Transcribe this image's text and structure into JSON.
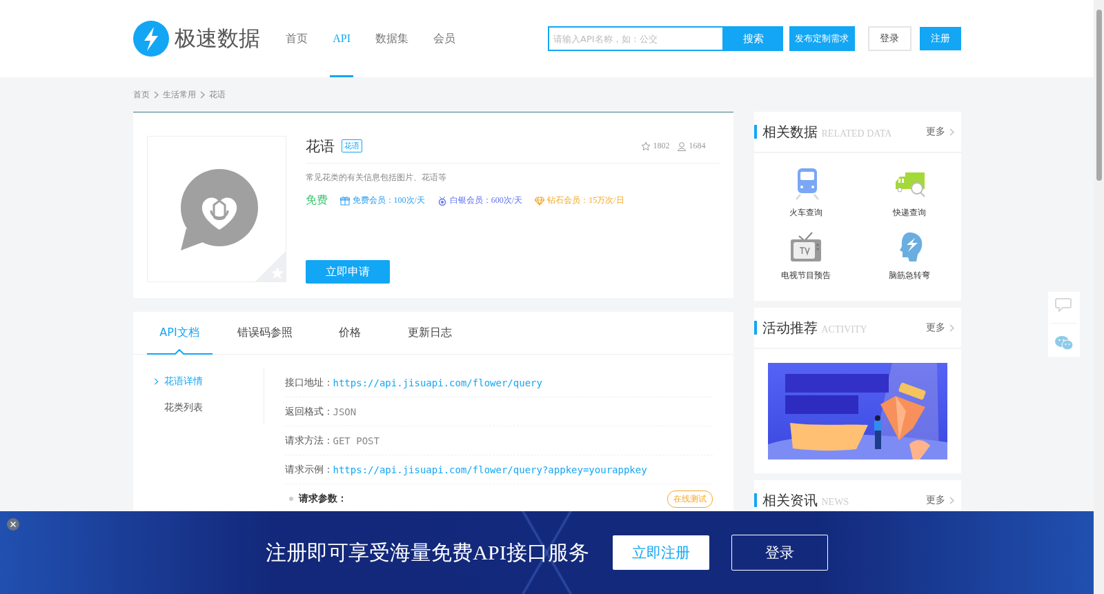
{
  "header": {
    "logo_text": "极速数据",
    "nav": [
      {
        "label": "首页",
        "selected": false
      },
      {
        "label": "API",
        "selected": true
      },
      {
        "label": "数据集",
        "selected": false
      },
      {
        "label": "会员",
        "selected": false
      }
    ],
    "search": {
      "placeholder": "请输入API名称，如：公交",
      "button": "搜索"
    },
    "publish_button": "发布定制需求",
    "login_button": "登录",
    "register_button": "注册"
  },
  "breadcrumb": [
    "首页",
    "生活常用",
    "花语"
  ],
  "api": {
    "title": "花语",
    "tag": "花语",
    "favorites": "1802",
    "users": "1684",
    "description": "常见花类的有关信息包括图片、花语等",
    "price": "免费",
    "quotas": [
      {
        "kind": "gift",
        "text": "免费会员：100次/天"
      },
      {
        "kind": "medal",
        "text": "白银会员：600次/天"
      },
      {
        "kind": "diamond",
        "text": "钻石会员：15万次/日"
      }
    ],
    "apply_button": "立即申请"
  },
  "doc": {
    "tabs": [
      {
        "label": "API文档",
        "selected": true
      },
      {
        "label": "错误码参照",
        "selected": false
      },
      {
        "label": "价格",
        "selected": false
      },
      {
        "label": "更新日志",
        "selected": false
      }
    ],
    "side_menu": [
      {
        "label": "花语详情",
        "selected": true
      },
      {
        "label": "花类列表",
        "selected": false
      }
    ],
    "fields": [
      {
        "label": "接口地址：",
        "value": "https://api.jisuapi.com/flower/query",
        "kind": "link"
      },
      {
        "label": "返回格式：",
        "value": "JSON",
        "kind": "plain"
      },
      {
        "label": "请求方法：",
        "value": "GET POST",
        "kind": "plain"
      },
      {
        "label": "请求示例：",
        "value": "https://api.jisuapi.com/flower/query?appkey=yourappkey",
        "kind": "link"
      }
    ],
    "params_heading": "请求参数：",
    "test_button": "在线测试"
  },
  "sidebar": {
    "related": {
      "title": "相关数据",
      "subtitle": "RELATED DATA",
      "more": "更多",
      "items": [
        {
          "label": "火车查询",
          "kind": "train"
        },
        {
          "label": "快递查询",
          "kind": "truck"
        },
        {
          "label": "电视节目预告",
          "kind": "tv"
        },
        {
          "label": "脑筋急转弯",
          "kind": "head"
        }
      ]
    },
    "activity": {
      "title": "活动推荐",
      "subtitle": "ACTIVITY",
      "more": "更多"
    },
    "news": {
      "title": "相关资讯",
      "subtitle": "NEWS",
      "more": "更多"
    }
  },
  "footer_bar": {
    "text": "注册即可享受海量免费API接口服务",
    "register_button": "立即注册",
    "login_button": "登录"
  }
}
